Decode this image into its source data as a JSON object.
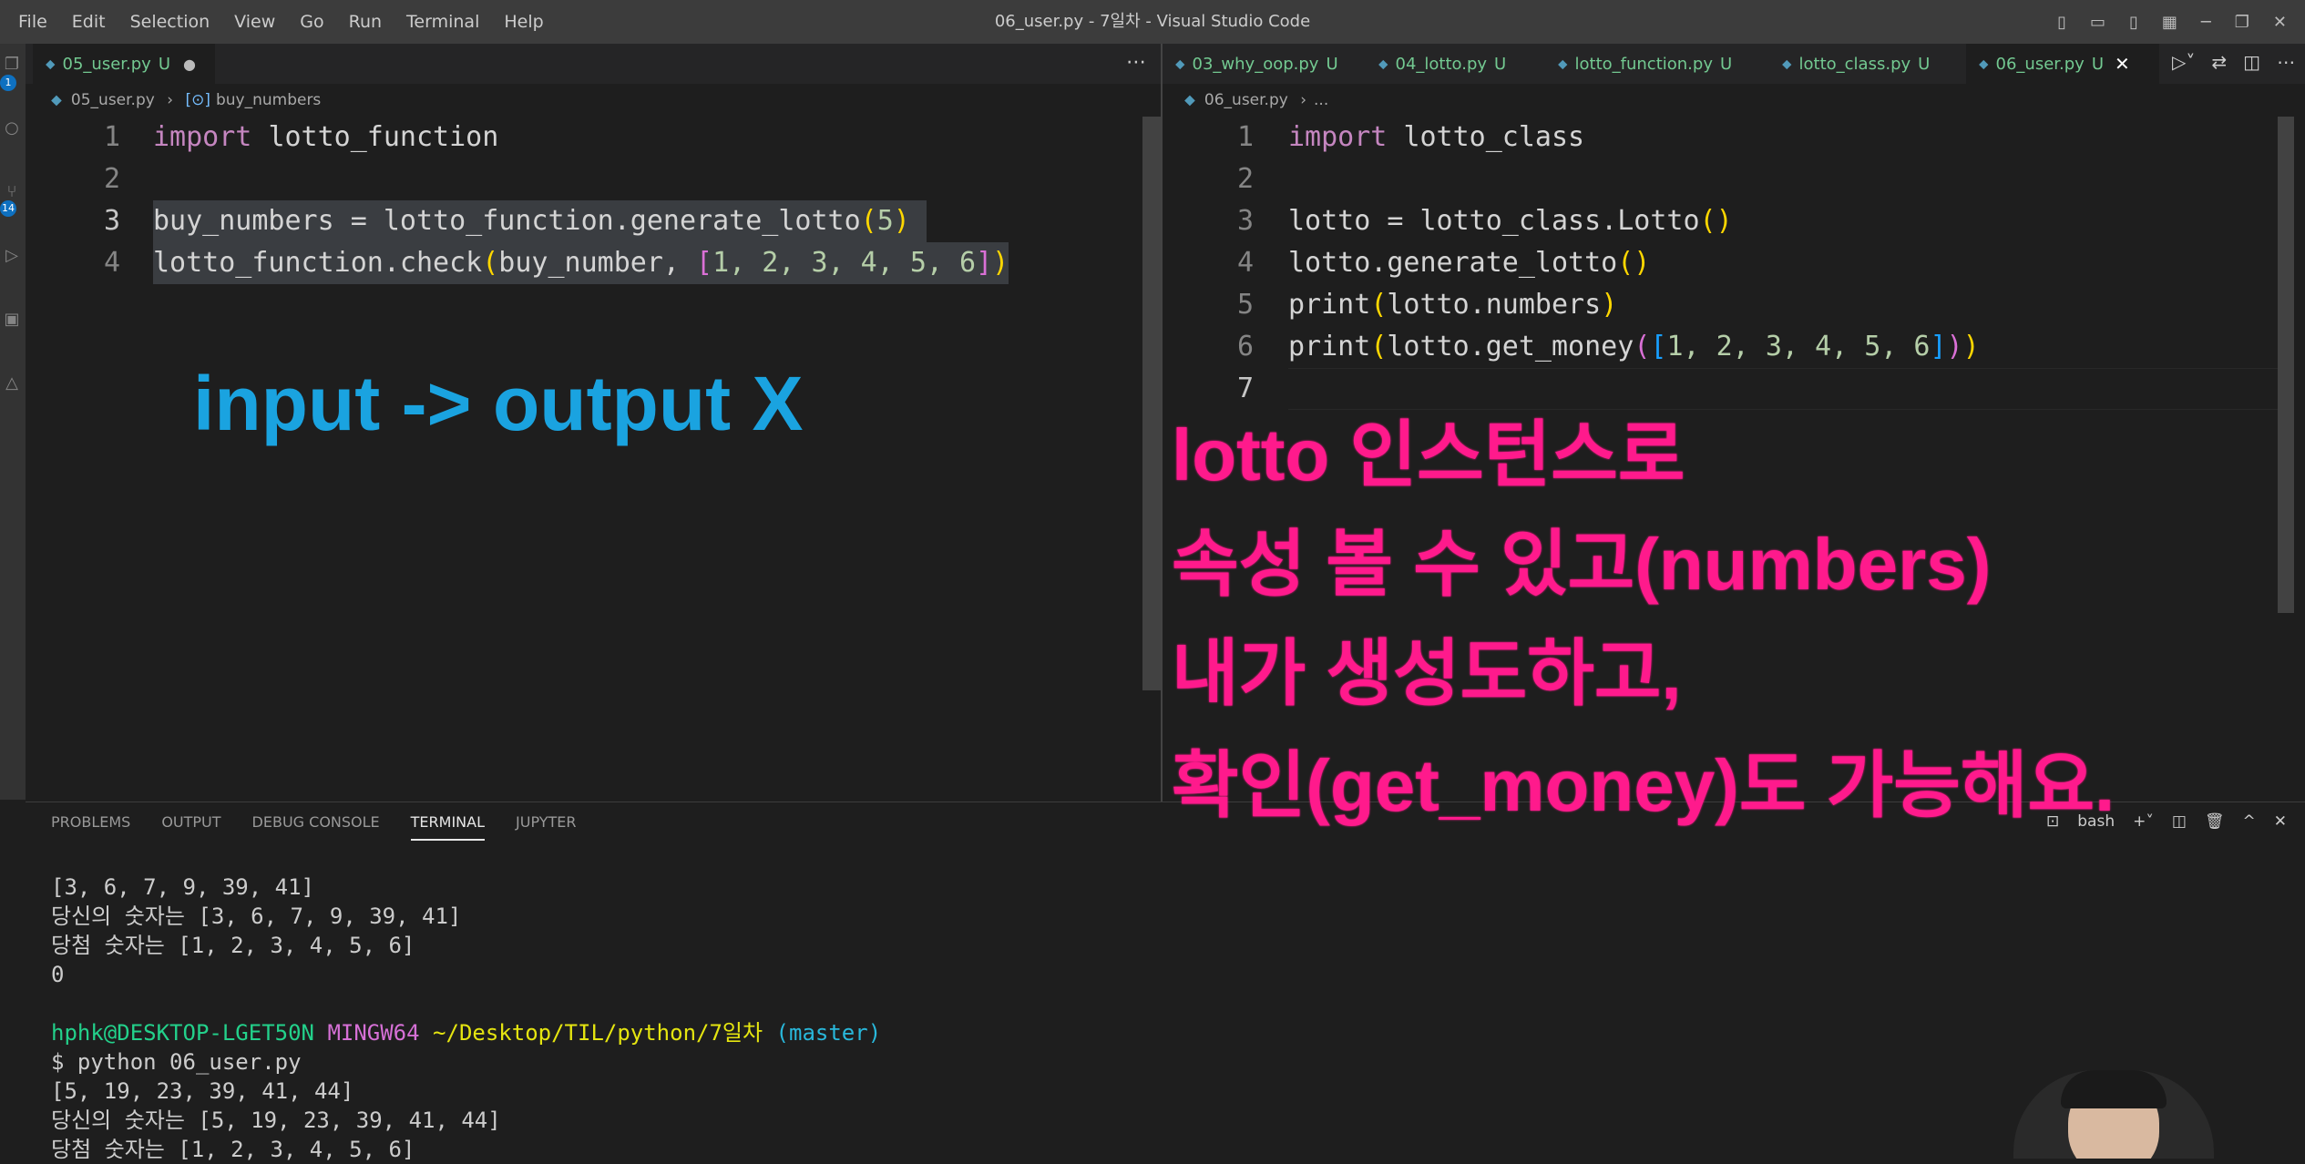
{
  "menu": [
    "File",
    "Edit",
    "Selection",
    "View",
    "Go",
    "Run",
    "Terminal",
    "Help"
  ],
  "window_title": "06_user.py - 7일차 - Visual Studio Code",
  "badges": {
    "explorer": "1",
    "source_control": "14"
  },
  "left_editor": {
    "tab": {
      "name": "05_user.py",
      "status": "U"
    },
    "breadcrumb": {
      "file": "05_user.py",
      "symbol": "buy_numbers"
    },
    "line_numbers": [
      "1",
      "2",
      "3",
      "4"
    ],
    "code": {
      "l1_kw": "import",
      "l1_mod": "lotto_function",
      "l3_var": "buy_numbers",
      "l3_eq": "=",
      "l3_call": "lotto_function.generate_lotto",
      "l3_arg": "5",
      "l4_call": "lotto_function.check",
      "l4_arg": "buy_number,",
      "l4_nums": [
        "1,",
        "2,",
        "3,",
        "4,",
        "5,",
        "6"
      ]
    }
  },
  "right_editor": {
    "tabs": [
      {
        "name": "03_why_oop.py",
        "status": "U"
      },
      {
        "name": "04_lotto.py",
        "status": "U"
      },
      {
        "name": "lotto_function.py",
        "status": "U"
      },
      {
        "name": "lotto_class.py",
        "status": "U"
      },
      {
        "name": "06_user.py",
        "status": "U"
      }
    ],
    "breadcrumb": {
      "file": "06_user.py",
      "rest": "..."
    },
    "line_numbers": [
      "1",
      "2",
      "3",
      "4",
      "5",
      "6",
      "7"
    ],
    "code": {
      "l1_kw": "import",
      "l1_mod": "lotto_class",
      "l3": "lotto = lotto_class.Lotto",
      "l4": "lotto.generate_lotto",
      "l5_fn": "print",
      "l5_arg": "lotto.numbers",
      "l6_fn": "print",
      "l6_call": "lotto.get_money",
      "l6_nums": [
        "1,",
        "2,",
        "3,",
        "4,",
        "5,",
        "6"
      ]
    }
  },
  "annotations": {
    "blue": "input -> output X",
    "pink": [
      "lotto 인스턴스로",
      "속성 볼 수 있고(numbers)",
      "내가 생성도하고,",
      "확인(get_money)도 가능해요."
    ]
  },
  "panel": {
    "tabs": [
      "PROBLEMS",
      "OUTPUT",
      "DEBUG CONSOLE",
      "TERMINAL",
      "JUPYTER"
    ],
    "active_tab": "TERMINAL",
    "shell": "bash"
  },
  "terminal": {
    "lines": [
      "[3, 6, 7, 9, 39, 41]",
      "당신의 숫자는 [3, 6, 7, 9, 39, 41]",
      "당첨 숫자는 [1, 2, 3, 4, 5, 6]",
      "0",
      "",
      "",
      "$ python 06_user.py",
      "[5, 19, 23, 39, 41, 44]",
      "당신의 숫자는 [5, 19, 23, 39, 41, 44]",
      "당첨 숫자는 [1, 2, 3, 4, 5, 6]"
    ],
    "prompt": {
      "user": "hphk@DESKTOP-LGET50N",
      "env": "MINGW64",
      "path": "~/Desktop/TIL/python/7일차",
      "branch": "(master)"
    }
  }
}
